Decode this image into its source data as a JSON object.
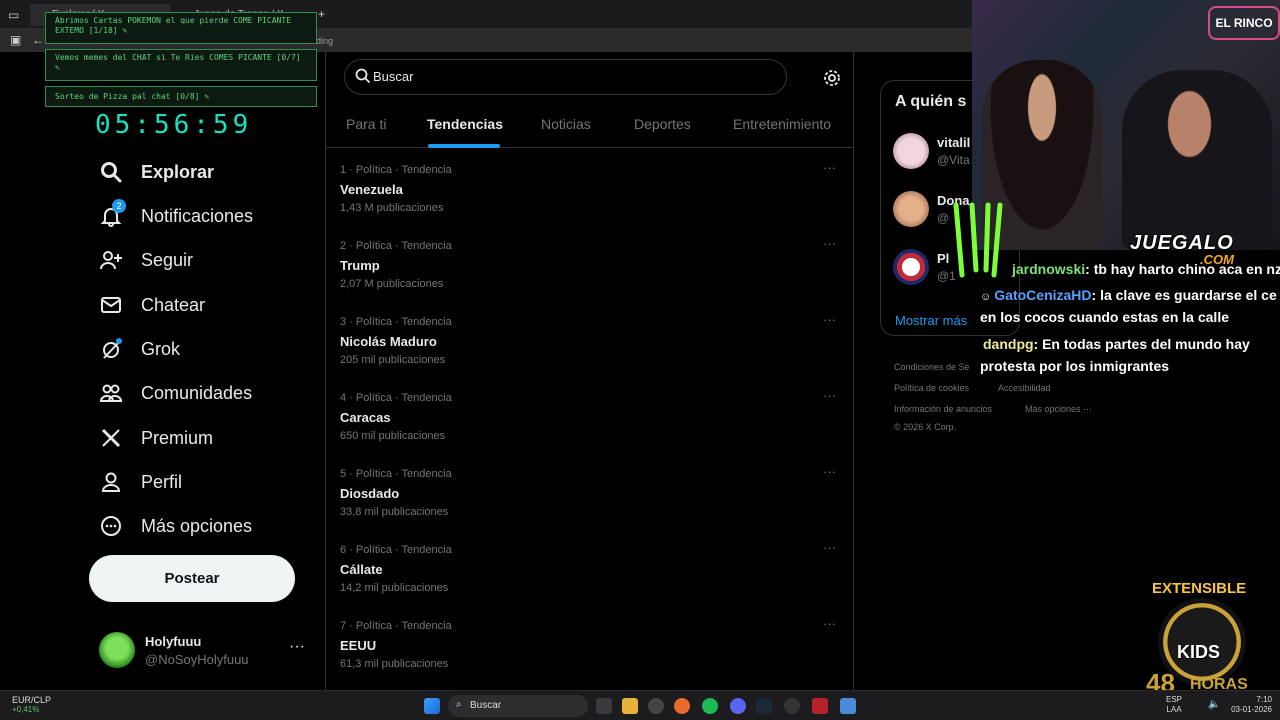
{
  "browser": {
    "tabs": [
      "Explorar / X",
      "Juego de Tronos / X"
    ],
    "address_hint": "ding"
  },
  "overlays": {
    "items": [
      {
        "text": "Abrimos Cartas POKEMON el que pierde COME PICANTE EXTEMO [1/18]"
      },
      {
        "text": "Vemos memes del CHAT si Te Ries COMES PICANTE [0/7]"
      },
      {
        "text": "Sorteo de Pizza pal chat [0/8]"
      }
    ],
    "clock": "05:56:59"
  },
  "nav": {
    "items": [
      {
        "label": "Explorar",
        "icon": "search-icon",
        "active": true
      },
      {
        "label": "Notificaciones",
        "icon": "bell-icon",
        "badge": "2"
      },
      {
        "label": "Seguir",
        "icon": "person-add-icon"
      },
      {
        "label": "Chatear",
        "icon": "mail-icon"
      },
      {
        "label": "Grok",
        "icon": "grok-icon"
      },
      {
        "label": "Comunidades",
        "icon": "people-icon"
      },
      {
        "label": "Premium",
        "icon": "x-logo-icon"
      },
      {
        "label": "Perfil",
        "icon": "person-icon"
      },
      {
        "label": "Más opciones",
        "icon": "more-circle-icon"
      }
    ],
    "post_label": "Postear",
    "profile": {
      "name": "Holyfuuu",
      "handle": "@NoSoyHolyfuuu",
      "more": "···"
    }
  },
  "main": {
    "search_placeholder": "Buscar",
    "tabs": [
      "Para ti",
      "Tendencias",
      "Noticias",
      "Deportes",
      "Entretenimiento"
    ],
    "active_tab": "Tendencias",
    "trends": [
      {
        "meta": "1 · Política · Tendencia",
        "name": "Venezuela",
        "count": "1,43 M publicaciones"
      },
      {
        "meta": "2 · Política · Tendencia",
        "name": "Trump",
        "count": "2,07 M publicaciones"
      },
      {
        "meta": "3 · Política · Tendencia",
        "name": "Nicolás Maduro",
        "count": "205 mil publicaciones"
      },
      {
        "meta": "4 · Política · Tendencia",
        "name": "Caracas",
        "count": "650 mil publicaciones"
      },
      {
        "meta": "5 · Política · Tendencia",
        "name": "Diosdado",
        "count": "33,8 mil publicaciones"
      },
      {
        "meta": "6 · Política · Tendencia",
        "name": "Cállate",
        "count": "14,2 mil publicaciones"
      },
      {
        "meta": "7 · Política · Tendencia",
        "name": "EEUU",
        "count": "61,3 mil publicaciones"
      }
    ],
    "more_glyph": "···"
  },
  "right": {
    "who_title": "A quién s",
    "who": [
      {
        "name": "vitalil",
        "handle": "@Vita"
      },
      {
        "name": "Dona",
        "handle": "@"
      },
      {
        "name": "Pl",
        "handle": "@1"
      }
    ],
    "show_more": "Mostrar más",
    "footer": [
      "Condiciones de Se",
      "Política de cookies",
      "Accesibilidad",
      "Información de anuncios",
      "Más opciones ···",
      "© 2026 X Corp."
    ]
  },
  "stream": {
    "sign": "EL RINCO",
    "logo": "JUEGALO",
    "logo_sub": ".COM",
    "chat": [
      {
        "user": "jardnowski",
        "text": ": tb hay harto chino aca en nz",
        "color": "green"
      },
      {
        "user": "GatoCenizaHD",
        "text": ": la clave es guardarse el ce",
        "continuation": "en los cocos cuando estas en la calle",
        "color": "blue"
      },
      {
        "user": "dandpg",
        "text": ": En todas partes del mundo hay",
        "continuation": "protesta por los inmigrantes",
        "color": "yellow"
      }
    ],
    "badge_title": "EXTENSIBLE",
    "badge_kids": "KIDS",
    "badge_hours": "48",
    "badge_hours_label": "HORAS"
  },
  "taskbar": {
    "ticker_pair": "EUR/CLP",
    "ticker_delta": "+0,41%",
    "search_label": "Buscar",
    "lang_top": "ESP",
    "lang_bottom": "LAA",
    "time": "7:10",
    "date": "03-01-2026"
  },
  "colors": {
    "accent": "#1d9bf0",
    "overlay_green": "#5bd37a",
    "clock": "#18e0c0"
  }
}
